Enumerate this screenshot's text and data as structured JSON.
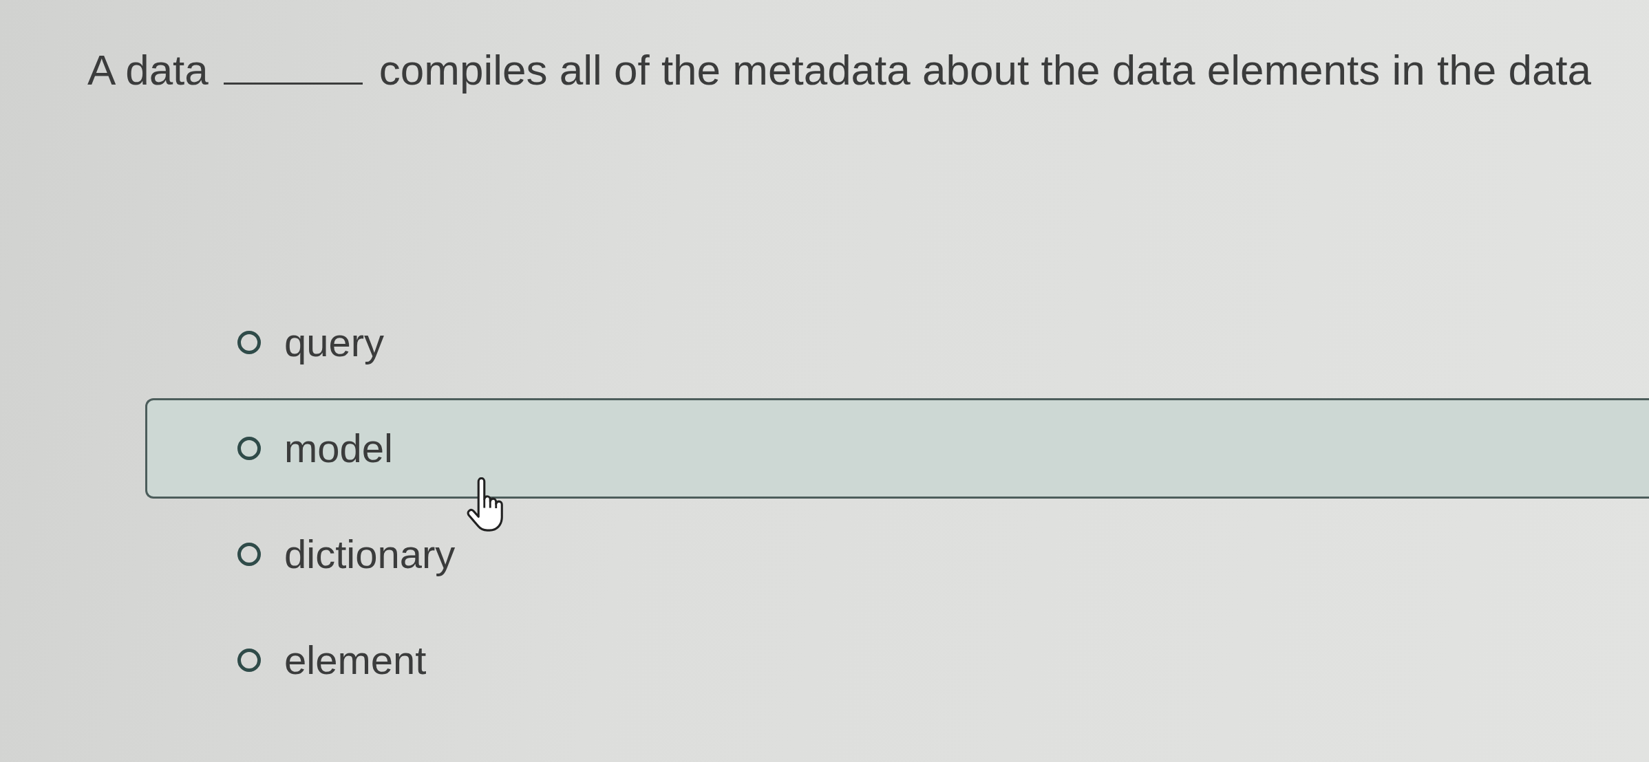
{
  "question": {
    "text_before_blank": "A data",
    "text_after_blank": "compiles all of the metadata about the data elements in the data"
  },
  "options": [
    {
      "label": "query",
      "selected": false,
      "highlighted": false
    },
    {
      "label": "model",
      "selected": false,
      "highlighted": true
    },
    {
      "label": "dictionary",
      "selected": false,
      "highlighted": false
    },
    {
      "label": "element",
      "selected": false,
      "highlighted": false
    }
  ]
}
